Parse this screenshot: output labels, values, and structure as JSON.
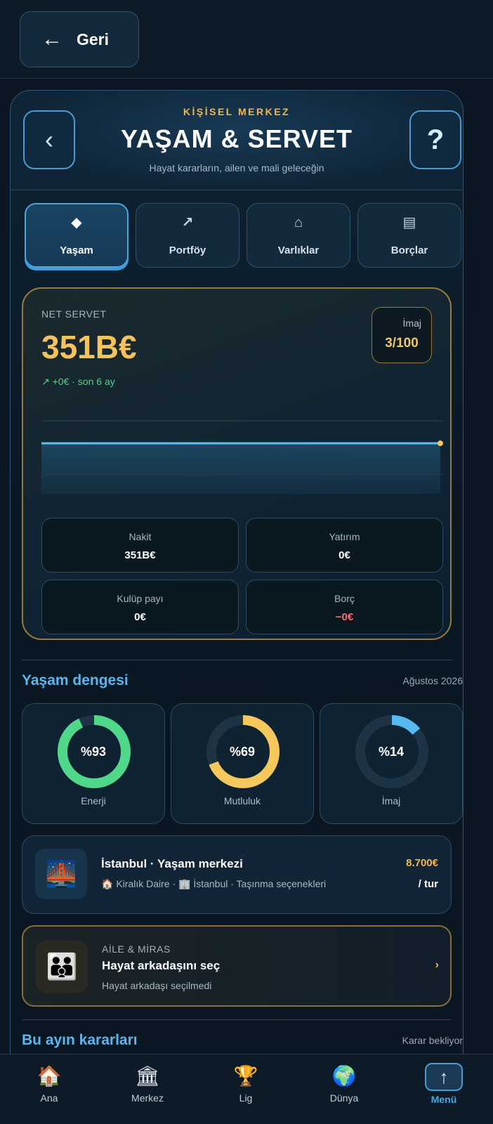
{
  "topbar": {
    "back_label": "Geri",
    "back_arrow": "←"
  },
  "header": {
    "kicker": "KİŞİSEL MERKEZ",
    "title": "YAŞAM & SERVET",
    "subtitle": "Hayat kararların, ailen ve mali geleceğin",
    "prev_glyph": "‹",
    "help_glyph": "?"
  },
  "tabs": [
    {
      "label": "Yaşam",
      "icon": "diamond-icon",
      "glyph": "◆",
      "active": true
    },
    {
      "label": "Portföy",
      "icon": "trend-arrow-icon",
      "glyph": "↗",
      "active": false
    },
    {
      "label": "Varlıklar",
      "icon": "house-icon",
      "glyph": "⌂",
      "active": false
    },
    {
      "label": "Borçlar",
      "icon": "ledger-icon",
      "glyph": "▤",
      "active": false
    }
  ],
  "wealth": {
    "label": "NET SERVET",
    "value": "351B€",
    "change": "↗ +0€ · son 6 ay",
    "imaj_label": "İmaj",
    "imaj_value": "3/100",
    "stats": [
      {
        "label": "Nakit",
        "value": "351B€",
        "negative": false
      },
      {
        "label": "Yatırım",
        "value": "0€",
        "negative": false
      },
      {
        "label": "Kulüp payı",
        "value": "0€",
        "negative": false
      },
      {
        "label": "Borç",
        "value": "−0€",
        "negative": true
      }
    ]
  },
  "chart_data": {
    "type": "line",
    "series": [
      {
        "values": [
          351,
          351,
          351,
          351,
          351,
          351
        ]
      }
    ]
  },
  "life_balance": {
    "title": "Yaşam dengesi",
    "date": "Ağustos 2026",
    "rings": [
      {
        "label": "Enerji",
        "value_text": "%93",
        "percent": 93,
        "color": "#4fd88a"
      },
      {
        "label": "Mutluluk",
        "value_text": "%69",
        "percent": 69,
        "color": "#f6c75a"
      },
      {
        "label": "İmaj",
        "value_text": "%14",
        "percent": 14,
        "color": "#56b9f0"
      }
    ]
  },
  "city": {
    "title": "İstanbul · Yaşam merkezi",
    "subtitle": "🏠 Kiralık Daire · 🏢 İstanbul · Taşınma seçenekleri",
    "price": "8.700€",
    "per": "/ tur",
    "thumb_icon": "bridge-night-icon",
    "thumb_glyph": "🌉"
  },
  "family": {
    "kicker": "AİLE & MİRAS",
    "title": "Hayat arkadaşını seç",
    "subtitle": "Hayat arkadaşı seçilmedi",
    "chevron": "›",
    "thumb_icon": "family-icon",
    "thumb_glyph": "👪"
  },
  "decisions": {
    "title": "Bu ayın kararları",
    "status": "Karar bekliyor"
  },
  "bottom_nav": [
    {
      "label": "Ana",
      "icon": "home-icon",
      "glyph": "🏠"
    },
    {
      "label": "Merkez",
      "icon": "bank-icon",
      "glyph": "🏛"
    },
    {
      "label": "Lig",
      "icon": "trophy-icon",
      "glyph": "🏆"
    },
    {
      "label": "Dünya",
      "icon": "globe-icon",
      "glyph": "🌍"
    },
    {
      "label": "Menü",
      "icon": "up-arrow-icon",
      "glyph": "↑",
      "active": true
    }
  ]
}
